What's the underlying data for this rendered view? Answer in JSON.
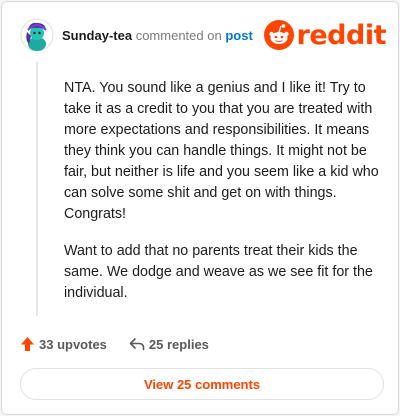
{
  "comment": {
    "username": "Sunday-tea",
    "action_text": "commented on",
    "target_text": "post",
    "paragraphs": [
      "NTA. You sound like a genius and I like it! Try to take it as a credit to you that you are treated with more expectations and responsibilities. It means they think you can handle things. It might not be fair, but neither is life and you seem like a kid who can solve some shit and get on with things. Congrats!",
      "Want to add that no parents treat their kids the same. We dodge and weave as we see fit for the individual."
    ]
  },
  "brand": {
    "logo_text": "reddit",
    "color": "#ff4500"
  },
  "actions": {
    "upvotes_label": "33 upvotes",
    "replies_label": "25 replies"
  },
  "view_button": {
    "label": "View 25 comments"
  },
  "colors": {
    "accent": "#ff4500",
    "link": "#0079d3",
    "text": "#1c1c1c",
    "muted": "#7c7c7c"
  }
}
